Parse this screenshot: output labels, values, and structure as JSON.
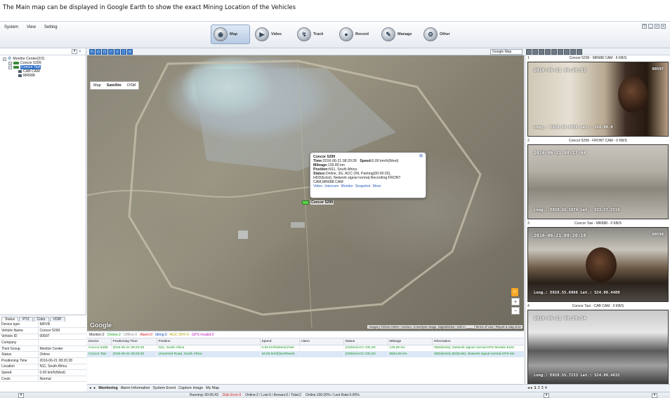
{
  "caption": "The Main map can be displayed in Google Earth to show the exact Mining Location of the Vehicles",
  "menu": [
    "System",
    "View",
    "Setting"
  ],
  "modules": [
    {
      "label": "Map",
      "icon": "map-icon",
      "active": true
    },
    {
      "label": "Video",
      "icon": "video-icon",
      "active": false
    },
    {
      "label": "Track",
      "icon": "track-icon",
      "active": false
    },
    {
      "label": "Record",
      "icon": "record-icon",
      "active": false
    },
    {
      "label": "Manage",
      "icon": "manage-icon",
      "active": false
    },
    {
      "label": "Other",
      "icon": "other-icon",
      "active": false
    }
  ],
  "tree": {
    "root": "Monitor Center(2/2)",
    "vehicles": [
      {
        "name": "Concor 5299",
        "expanded": false
      },
      {
        "name": "Concor Taxi",
        "expanded": true,
        "selected": true,
        "cameras": [
          "CAB CAM",
          "MR688"
        ]
      }
    ]
  },
  "details": {
    "tabs": [
      "Status",
      "PTZ",
      "Color",
      "VOIP"
    ],
    "rows": [
      {
        "label": "Device type",
        "value": "MDVR"
      },
      {
        "label": "Vehicle Name",
        "value": "Concor 5299"
      },
      {
        "label": "Vehicle ID",
        "value": "00597"
      },
      {
        "label": "Company",
        "value": ""
      },
      {
        "label": "Their Group",
        "value": "Monitor Center"
      },
      {
        "label": "Status",
        "value": "Online"
      },
      {
        "label": "Positioning Time",
        "value": "2016-06-21 08:20:28"
      },
      {
        "label": "Location",
        "value": "N11, South Africa"
      },
      {
        "label": "Speed",
        "value": "0.00 km/h(West)"
      },
      {
        "label": "Costs",
        "value": "Normal"
      }
    ]
  },
  "map": {
    "provider": "Google Map",
    "types": [
      "Map",
      "Satellite",
      "OSM"
    ],
    "logo": "Google",
    "attribution": "Imagery ©2016 CNES / Astrium, Cnes/Spot Image, DigitalGlobe | 100 m ____ | Terms of Use | Report a map error",
    "zoom_in": "+",
    "zoom_out": "−",
    "marker_label": "Concor 5299",
    "popup": {
      "title": "Concor 5299",
      "time_label": "Time:",
      "time": "2016-06-21 08:20:28",
      "speed_label": "Speed:",
      "speed": "0.00 km/h(West)",
      "mileage_label": "Mileage:",
      "mileage": "139.80 km",
      "position_label": "Position:",
      "position": "N11, South Africa",
      "status_label": "Status:",
      "status": "Online, 3G, ACC ON, Parking(00:00:20),",
      "status2": "HDD(Exist), Network signal normal,Recording:FRONT",
      "status3": "CAM,MR688 CAM",
      "links": [
        "Video",
        "Intercom",
        "Monitor",
        "Snapshot",
        "More"
      ]
    }
  },
  "monitor_summary": {
    "monitor": "Monitor:2",
    "online": "Online:2",
    "offline": "Offline:0",
    "alarm": "Alarm:0",
    "idling": "Idling:0",
    "acc_off": "ACC OFF:0",
    "gps_invalid": "GPS Invalid:0"
  },
  "grid": {
    "columns": [
      "Device",
      "Positioning Time",
      "Position",
      "Speed",
      "Alarm",
      "Status",
      "Mileage",
      "Information"
    ],
    "rows": [
      {
        "device": "Concor 5299",
        "time": "2016-06-21 08:20:28",
        "position": "N11, South Africa",
        "speed": "0.00 km/h(West),Park",
        "alarm": "",
        "status": "(Online)ACC ON,3G",
        "mileage": "139.80 km",
        "info": "HDD(Exist), Network signal normal,GPS Module Exist"
      },
      {
        "device": "Concor Taxi",
        "time": "2016-06-21 08:20:25",
        "position": "Unnamed Road, South Africa",
        "speed": "10.00 km/h(Northwest",
        "alarm": "",
        "status": "(Online)ACC ON,3G",
        "mileage": "6554.05 km",
        "info": "HDD(Exist),SD(Exist), Network signal normal,GPS Mo"
      }
    ],
    "tabs": [
      "Monitoring",
      "Alarm Information",
      "System Event",
      "Capture Image",
      "My Map"
    ]
  },
  "videos": [
    {
      "num": "1",
      "title": "Concor 5299 - MR688 CAM - 6 KB/S",
      "time": "2016-06-21 08:20:33",
      "id": "00597",
      "gps": "Long.: E028.56.0056 Lat.: S24.00.0"
    },
    {
      "num": "2",
      "title": "Concor 5299 - FRONT CAM - 0 KB/S",
      "time": "2016-06-21 08:17:44",
      "id": "",
      "gps": "Long.: E028.56.1074 Lat.: S23.57.2516"
    },
    {
      "num": "3",
      "title": "Concor Taxi - MR688 - 0 KB/S",
      "time": "2016-06-21 08:20:18",
      "id": "00598",
      "gps": "Long.: E028.55.6966 Lat.: S24.00.4480"
    },
    {
      "num": "4",
      "title": "Concor Taxi - CAB CAM - 0 KB/S",
      "time": "2016-06-21 08:20:54",
      "id": "",
      "gps": "Long.: E028.55.7233 Lat.: S24.00.4632"
    }
  ],
  "video_pages": [
    "1",
    "2",
    "3",
    "4"
  ],
  "status": {
    "running": "Running: 00:06:43",
    "disk_error": "Disk Error:0",
    "online": "Online:2 / Lost:0 / Arrears:0 / Total:2",
    "online_rate": "Online:100.00% / Lost Rate:0.00%"
  }
}
